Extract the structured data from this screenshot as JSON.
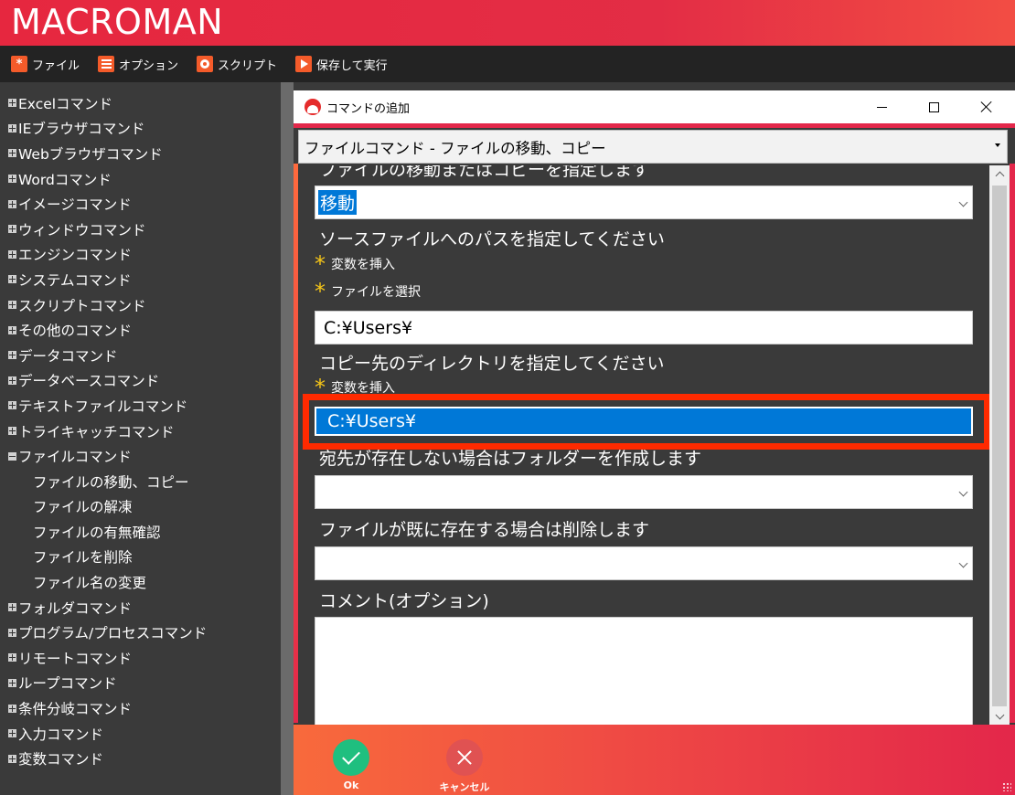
{
  "app": {
    "title": "MACROMAN"
  },
  "menubar": {
    "items": [
      {
        "label": "ファイル",
        "icon": "asterisk-icon"
      },
      {
        "label": "オプション",
        "icon": "menu-lines-icon"
      },
      {
        "label": "スクリプト",
        "icon": "record-icon"
      },
      {
        "label": "保存して実行",
        "icon": "play-icon"
      }
    ],
    "icon_color": "#f45b2a"
  },
  "sidebar": {
    "items": [
      {
        "label": "Excelコマンド",
        "level": 0,
        "expanded": false
      },
      {
        "label": "IEブラウザコマンド",
        "level": 0,
        "expanded": false
      },
      {
        "label": "Webブラウザコマンド",
        "level": 0,
        "expanded": false
      },
      {
        "label": "Wordコマンド",
        "level": 0,
        "expanded": false
      },
      {
        "label": "イメージコマンド",
        "level": 0,
        "expanded": false
      },
      {
        "label": "ウィンドウコマンド",
        "level": 0,
        "expanded": false
      },
      {
        "label": "エンジンコマンド",
        "level": 0,
        "expanded": false
      },
      {
        "label": "システムコマンド",
        "level": 0,
        "expanded": false
      },
      {
        "label": "スクリプトコマンド",
        "level": 0,
        "expanded": false
      },
      {
        "label": "その他のコマンド",
        "level": 0,
        "expanded": false
      },
      {
        "label": "データコマンド",
        "level": 0,
        "expanded": false
      },
      {
        "label": "データベースコマンド",
        "level": 0,
        "expanded": false
      },
      {
        "label": "テキストファイルコマンド",
        "level": 0,
        "expanded": false
      },
      {
        "label": "トライキャッチコマンド",
        "level": 0,
        "expanded": false
      },
      {
        "label": "ファイルコマンド",
        "level": 0,
        "expanded": true
      },
      {
        "label": "ファイルの移動、コピー",
        "level": 1
      },
      {
        "label": "ファイルの解凍",
        "level": 1
      },
      {
        "label": "ファイルの有無確認",
        "level": 1
      },
      {
        "label": "ファイルを削除",
        "level": 1
      },
      {
        "label": "ファイル名の変更",
        "level": 1
      },
      {
        "label": "フォルダコマンド",
        "level": 0,
        "expanded": false
      },
      {
        "label": "プログラム/プロセスコマンド",
        "level": 0,
        "expanded": false
      },
      {
        "label": "リモートコマンド",
        "level": 0,
        "expanded": false
      },
      {
        "label": "ループコマンド",
        "level": 0,
        "expanded": false
      },
      {
        "label": "条件分岐コマンド",
        "level": 0,
        "expanded": false
      },
      {
        "label": "入力コマンド",
        "level": 0,
        "expanded": false
      },
      {
        "label": "変数コマンド",
        "level": 0,
        "expanded": false
      }
    ]
  },
  "dialog": {
    "title": "コマンドの追加",
    "command_select": "ファイルコマンド - ファイルの移動、コピー",
    "form": {
      "operation_label": "ファイルの移動またはコピーを指定します",
      "operation_value": "移動",
      "source_label": "ソースファイルへのパスを指定してください",
      "insert_variable_link": "変数を挿入",
      "select_file_link": "ファイルを選択",
      "source_value": "C:¥Users¥",
      "dest_label": "コピー先のディレクトリを指定してください",
      "dest_insert_variable_link": "変数を挿入",
      "dest_value": "C:¥Users¥",
      "create_folder_label": "宛先が存在しない場合はフォルダーを作成します",
      "delete_existing_label": "ファイルが既に存在する場合は削除します",
      "comment_label": "コメント(オプション)",
      "comment_value": ""
    },
    "buttons": {
      "ok": "Ok",
      "cancel": "キャンセル"
    },
    "colors": {
      "accent": "#e3274a",
      "ok": "#1fbf7f",
      "cancel": "#e05252",
      "highlight": "#ff2a00",
      "selection": "#0078d7"
    }
  }
}
